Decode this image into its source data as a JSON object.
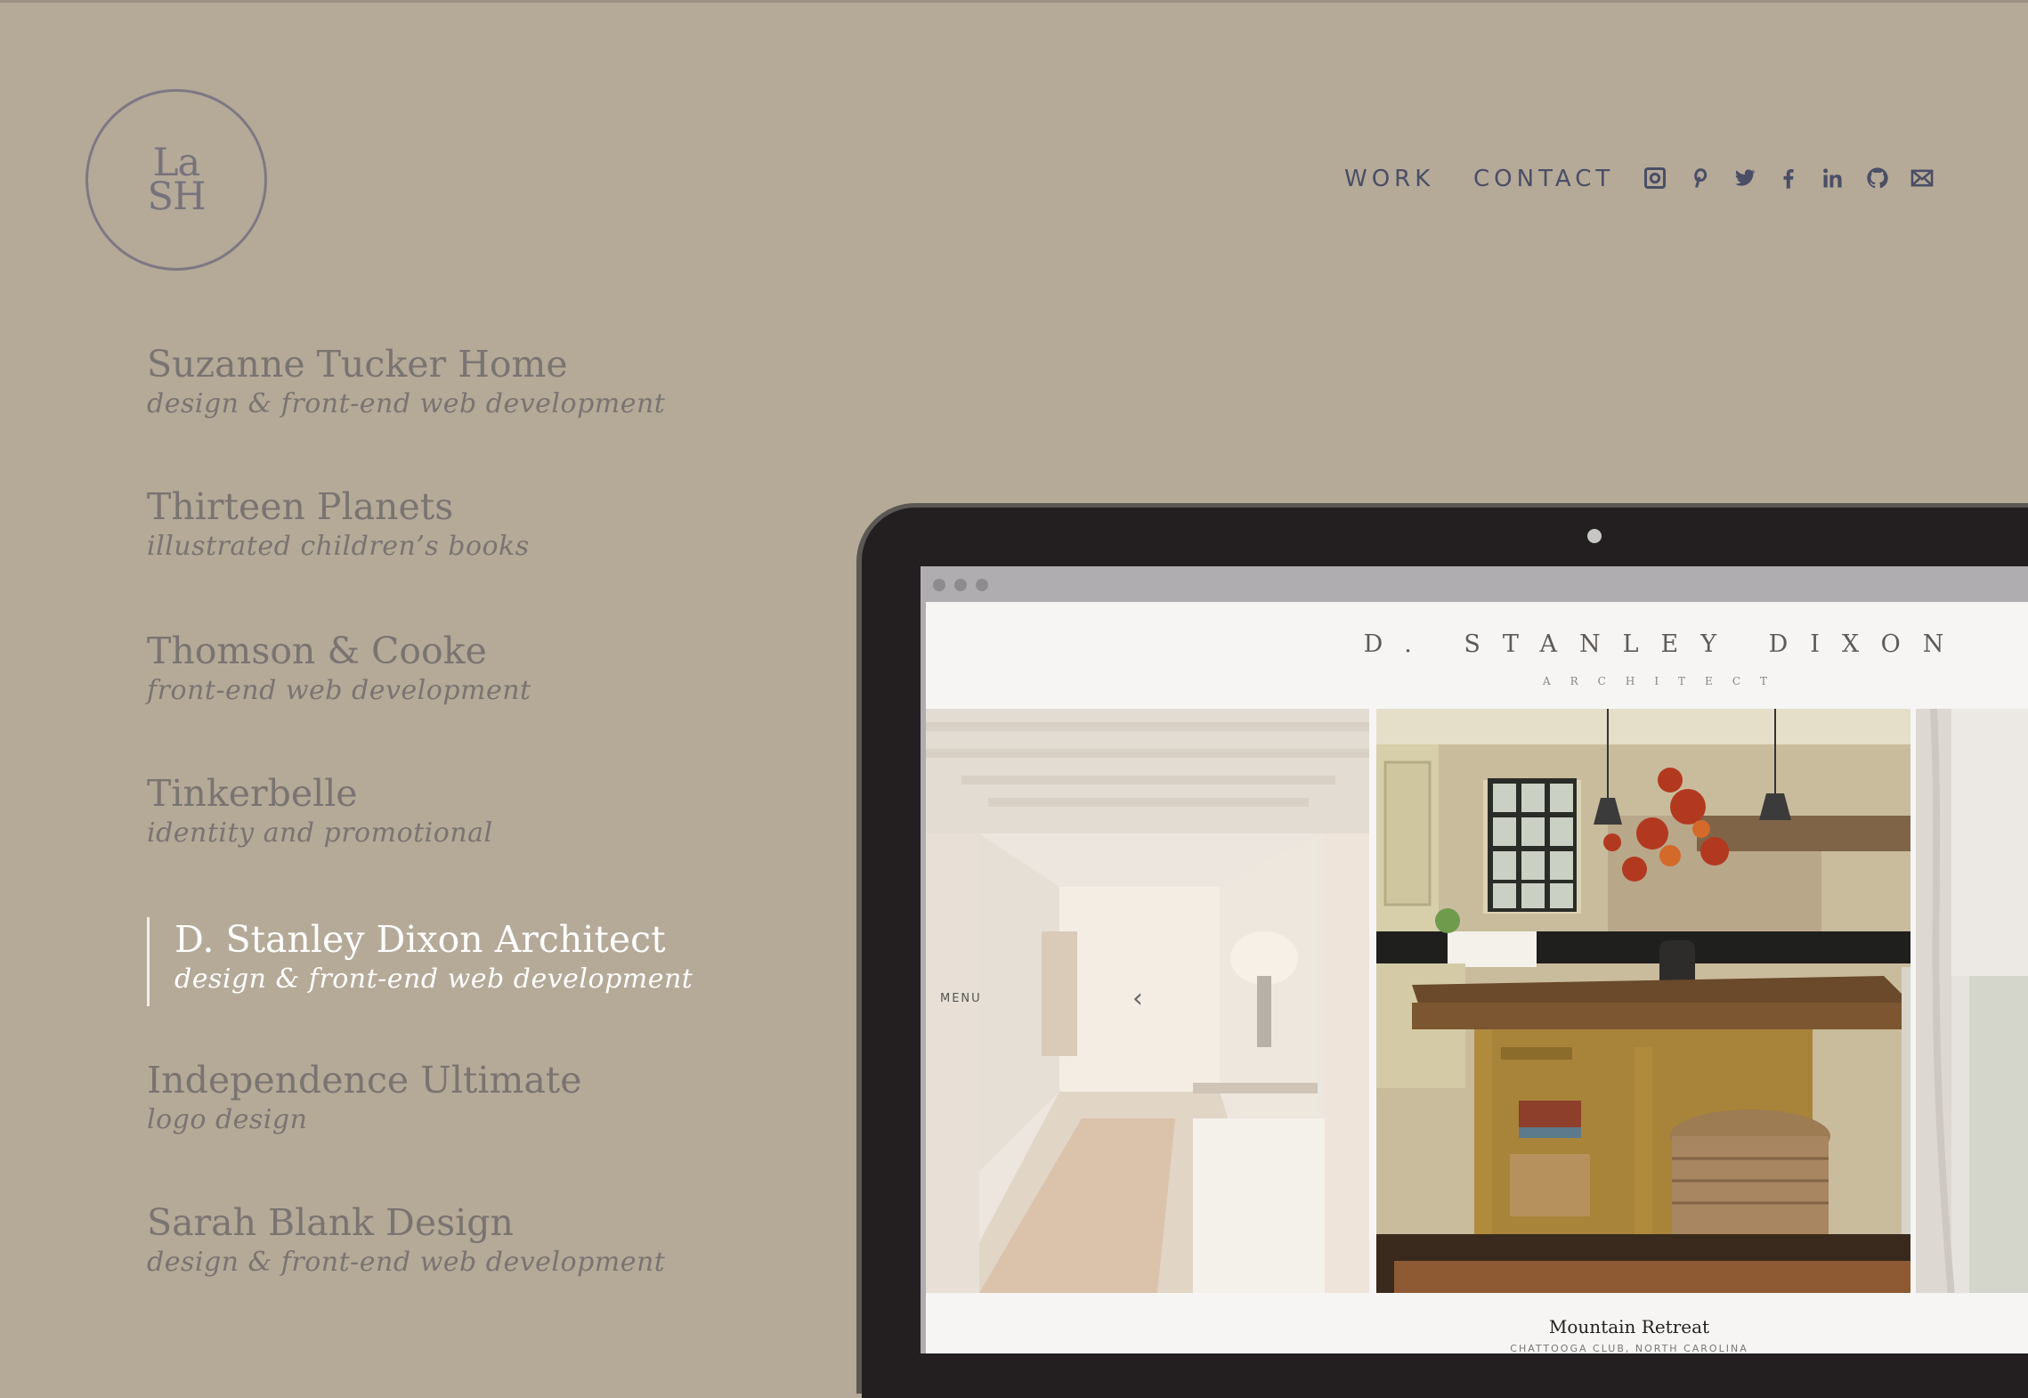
{
  "logo": {
    "line1": "La",
    "line2": "SH"
  },
  "nav": {
    "work": "WORK",
    "contact": "CONTACT"
  },
  "social": [
    "instagram-icon",
    "pinterest-icon",
    "twitter-icon",
    "facebook-icon",
    "linkedin-icon",
    "github-icon",
    "mail-icon"
  ],
  "projects": [
    {
      "title": "Suzanne Tucker Home",
      "subtitle": "design & front-end web development"
    },
    {
      "title": "Thirteen Planets",
      "subtitle": "illustrated children’s books"
    },
    {
      "title": "Thomson & Cooke",
      "subtitle": "front-end web development"
    },
    {
      "title": "Tinkerbelle",
      "subtitle": "identity and promotional"
    },
    {
      "title": "D. Stanley Dixon Architect",
      "subtitle": "design & front-end web development"
    },
    {
      "title": "Independence Ultimate",
      "subtitle": "logo design"
    },
    {
      "title": "Sarah Blank Design",
      "subtitle": "design & front-end web development"
    }
  ],
  "preview": {
    "brand": "D. STANLEY DIXON",
    "sub": "ARCHITECT",
    "menu": "MENU",
    "caption_title": "Mountain Retreat",
    "caption_sub": "CHATTOOGA CLUB, NORTH CAROLINA"
  },
  "colors": {
    "background": "#b5a998",
    "nav": "#4a4e66",
    "active": "#ffffff",
    "muted": "#7a7471"
  }
}
